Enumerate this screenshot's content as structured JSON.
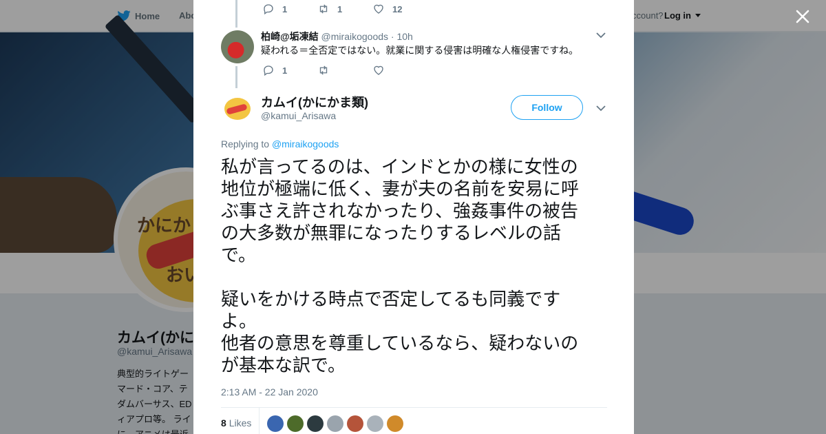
{
  "background": {
    "nav": {
      "home": "Home",
      "about": "Abo",
      "have_account": "ccount?",
      "login": "Log in"
    },
    "avatar": {
      "line1": "かにかま",
      "line2": "おい"
    },
    "profile": {
      "name": "カムイ(かに",
      "handle": "@kamui_Arisawa",
      "bio_lines": [
        "典型的ライトゲー",
        "マード・コア、テ",
        "ダムバーサス、ED",
        "ィアプロ等。 ライ",
        "に。アニメは最近"
      ]
    }
  },
  "thread": {
    "prev_actions": {
      "replies": "1",
      "retweets": "1",
      "likes": "12"
    },
    "reply": {
      "name": "柏崎@垢凍結",
      "handle": "@miraikogoods",
      "time": "· 10h",
      "text": "疑われる＝全否定ではない。就業に関する侵害は明確な人権侵害ですね。",
      "actions": {
        "replies": "1",
        "retweets": "",
        "likes": ""
      }
    },
    "tweet": {
      "name": "カムイ(かにかま類)",
      "handle": "@kamui_Arisawa",
      "follow_label": "Follow",
      "replying_prefix": "Replying to",
      "replying_to": "@miraikogoods",
      "lines": [
        "私が言ってるのは、インドとかの様に女性の",
        "地位が極端に低く、妻が夫の名前を安易に呼",
        "ぶ事さえ許されなかったり、強姦事件の被告",
        "の大多数が無罪になったりするレベルの話",
        "で。",
        "",
        "疑いをかける時点で否定してるも同義です",
        "よ。",
        "他者の意思を尊重しているなら、疑わないの",
        "が基本な訳で。"
      ],
      "timestamp": "2:13 AM - 22 Jan 2020",
      "likes_count": "8",
      "likes_label": "Likes",
      "liker_colors": [
        "#3a66b0",
        "#4d6b2a",
        "#2c3a3f",
        "#9aa4ad",
        "#b5543a",
        "#a9b2ba",
        "#d08a2a"
      ]
    }
  },
  "colors": {
    "accent": "#1da1f2",
    "text": "#14171a",
    "secondary": "#657786"
  }
}
